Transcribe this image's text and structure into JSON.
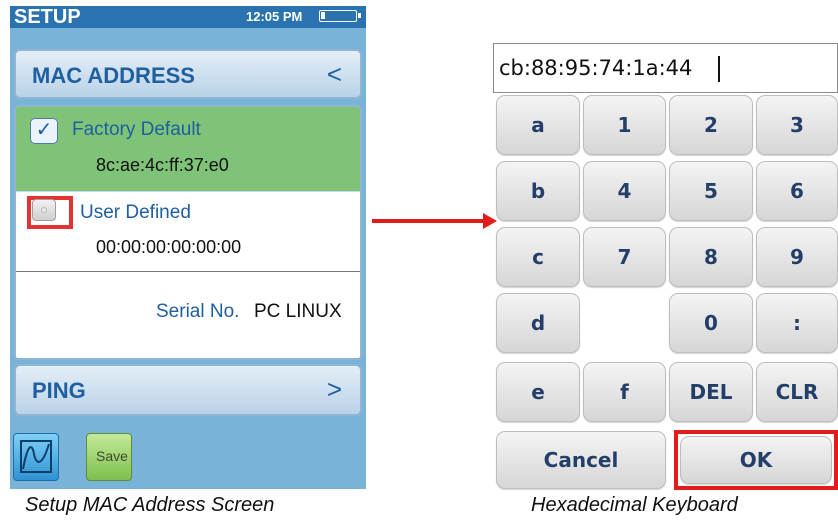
{
  "device": {
    "title": "SETUP",
    "time": "12:05 PM",
    "mac_section": {
      "label": "MAC ADDRESS",
      "chevron": "<"
    },
    "factory_default": {
      "label": "Factory Default",
      "checkmark": "✓",
      "mac": "8c:ae:4c:ff:37:e0",
      "checked": true
    },
    "user_defined": {
      "label": "User Defined",
      "mac": "00:00:00:00:00:00",
      "selected": false
    },
    "serial": {
      "label": "Serial No.",
      "value": "PC LINUX"
    },
    "ping_section": {
      "label": "PING",
      "chevron": ">"
    },
    "toolbar": {
      "chart_icon": "waveform-icon",
      "save_label": "Save"
    },
    "colors": {
      "header_bar": "#2a73b0",
      "background": "#7ab3d8",
      "selected_row": "#7fc379",
      "highlight": "#e53232"
    }
  },
  "keyboard": {
    "input_value": "cb:88:95:74:1a:44",
    "keys": {
      "a": "a",
      "one": "1",
      "two": "2",
      "three": "3",
      "b": "b",
      "four": "4",
      "five": "5",
      "six": "6",
      "c": "c",
      "seven": "7",
      "eight": "8",
      "nine": "9",
      "d": "d",
      "zero": "0",
      "colon": ":",
      "e": "e",
      "f": "f",
      "del": "DEL",
      "clr": "CLR",
      "cancel": "Cancel",
      "ok": "OK"
    }
  },
  "captions": {
    "left": "Setup MAC Address Screen",
    "right": "Hexadecimal Keyboard"
  }
}
